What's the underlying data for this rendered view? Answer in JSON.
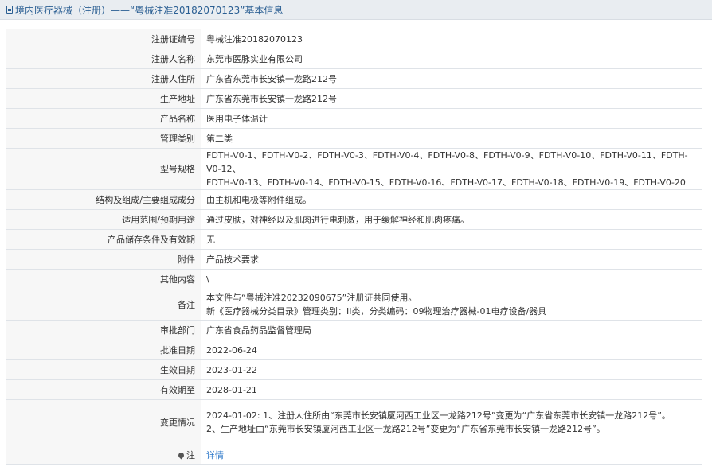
{
  "header": {
    "title": "境内医疗器械（注册）——“粤械注准20182070123”基本信息"
  },
  "fields": {
    "reg_no": {
      "label": "注册证编号",
      "value": "粤械注准20182070123"
    },
    "registrant_name": {
      "label": "注册人名称",
      "value": "东莞市医脉实业有限公司"
    },
    "registrant_address": {
      "label": "注册人住所",
      "value": "广东省东莞市长安镇一龙路212号"
    },
    "production_address": {
      "label": "生产地址",
      "value": "广东省东莞市长安镇一龙路212号"
    },
    "product_name": {
      "label": "产品名称",
      "value": "医用电子体温计"
    },
    "category": {
      "label": "管理类别",
      "value": "第二类"
    },
    "models": {
      "label": "型号规格",
      "line1": "FDTH-V0-1、FDTH-V0-2、FDTH-V0-3、FDTH-V0-4、FDTH-V0-8、FDTH-V0-9、FDTH-V0-10、FDTH-V0-11、FDTH-V0-12、",
      "line2": "FDTH-V0-13、FDTH-V0-14、FDTH-V0-15、FDTH-V0-16、FDTH-V0-17、FDTH-V0-18、FDTH-V0-19、FDTH-V0-20"
    },
    "structure": {
      "label": "结构及组成/主要组成成分",
      "value": "由主机和电极等附件组成。"
    },
    "scope": {
      "label": "适用范围/预期用途",
      "value": "通过皮肤，对神经以及肌肉进行电刺激，用于缓解神经和肌肉疼痛。"
    },
    "storage": {
      "label": "产品储存条件及有效期",
      "value": "无"
    },
    "attachment": {
      "label": "附件",
      "value": "产品技术要求"
    },
    "other": {
      "label": "其他内容",
      "value": "\\"
    },
    "remarks": {
      "label": "备注",
      "line1": "本文件与“粤械注准20232090675”注册证共同使用。",
      "line2": "新《医疗器械分类目录》管理类别：II类，分类编码：09物理治疗器械-01电疗设备/器具"
    },
    "approval_dept": {
      "label": "审批部门",
      "value": "广东省食品药品监督管理局"
    },
    "approval_date": {
      "label": "批准日期",
      "value": "2022-06-24"
    },
    "effective_date": {
      "label": "生效日期",
      "value": "2023-01-22"
    },
    "expiry_date": {
      "label": "有效期至",
      "value": "2028-01-21"
    },
    "changes": {
      "label": "变更情况",
      "line1": "2024-01-02: 1、注册人住所由“东莞市长安镇厦河西工业区一龙路212号”变更为“广东省东莞市长安镇一龙路212号”。",
      "line2": "2、生产地址由“东莞市长安镇厦河西工业区一龙路212号”变更为“广东省东莞市长安镇一龙路212号”。"
    },
    "note": {
      "label": "注",
      "link": "详情"
    }
  },
  "icons": {
    "title": "document-icon",
    "note": "pin-icon"
  },
  "colors": {
    "header_text": "#2b5f93",
    "link": "#2b77c9"
  }
}
